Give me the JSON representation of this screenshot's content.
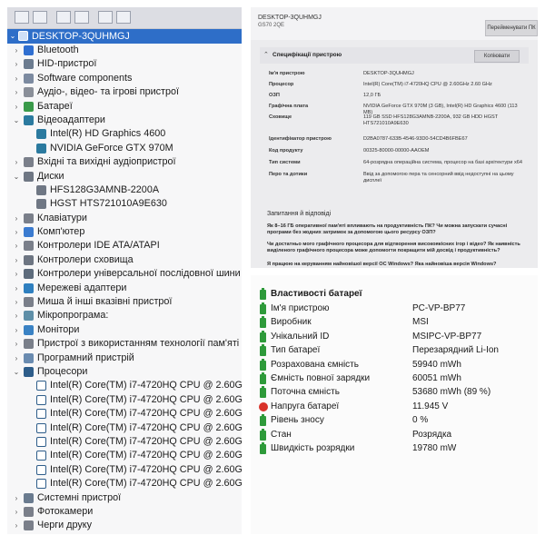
{
  "device_manager": {
    "root": "DESKTOP-3QUHMGJ",
    "items": [
      {
        "level": 1,
        "expander": "›",
        "icon": "bluetooth-icon",
        "label": "Bluetooth"
      },
      {
        "level": 1,
        "expander": "›",
        "icon": "hid-icon",
        "label": "HID-пристрої"
      },
      {
        "level": 1,
        "expander": "›",
        "icon": "software-components-icon",
        "label": "Software components"
      },
      {
        "level": 1,
        "expander": "›",
        "icon": "audio-icon",
        "label": "Аудіо-, відео- та ігрові пристрої"
      },
      {
        "level": 1,
        "expander": "›",
        "icon": "battery-icon",
        "label": "Батареї"
      },
      {
        "level": 1,
        "expander": "⌄",
        "icon": "display-adapter-icon",
        "label": "Відеоадаптери"
      },
      {
        "level": 2,
        "expander": "",
        "icon": "display-adapter-icon",
        "label": "Intel(R) HD Graphics 4600"
      },
      {
        "level": 2,
        "expander": "",
        "icon": "display-adapter-icon",
        "label": "NVIDIA GeForce GTX 970M"
      },
      {
        "level": 1,
        "expander": "›",
        "icon": "audio-io-icon",
        "label": "Вхідні та вихідні аудіопристрої"
      },
      {
        "level": 1,
        "expander": "⌄",
        "icon": "disk-icon",
        "label": "Диски"
      },
      {
        "level": 2,
        "expander": "",
        "icon": "disk-icon",
        "label": "HFS128G3AMNB-2200A"
      },
      {
        "level": 2,
        "expander": "",
        "icon": "disk-icon",
        "label": "HGST HTS721010A9E630"
      },
      {
        "level": 1,
        "expander": "›",
        "icon": "keyboard-icon",
        "label": "Клавіатури"
      },
      {
        "level": 1,
        "expander": "›",
        "icon": "computer-icon",
        "label": "Комп'ютер"
      },
      {
        "level": 1,
        "expander": "›",
        "icon": "ide-controller-icon",
        "label": "Контролери IDE ATA/ATAPI"
      },
      {
        "level": 1,
        "expander": "›",
        "icon": "storage-controller-icon",
        "label": "Контролери сховища"
      },
      {
        "level": 1,
        "expander": "›",
        "icon": "usb-controller-icon",
        "label": "Контролери універсальної послідовної шини"
      },
      {
        "level": 1,
        "expander": "›",
        "icon": "network-adapter-icon",
        "label": "Мережеві адаптери"
      },
      {
        "level": 1,
        "expander": "›",
        "icon": "mouse-icon",
        "label": "Миша й інші вказівні пристрої"
      },
      {
        "level": 1,
        "expander": "›",
        "icon": "firmware-icon",
        "label": "Мікропрограма:"
      },
      {
        "level": 1,
        "expander": "›",
        "icon": "monitor-icon",
        "label": "Монітори"
      },
      {
        "level": 1,
        "expander": "›",
        "icon": "memory-tech-icon",
        "label": "Пристрої з використанням технології пам'яті"
      },
      {
        "level": 1,
        "expander": "›",
        "icon": "software-device-icon",
        "label": "Програмний пристрій"
      },
      {
        "level": 1,
        "expander": "⌄",
        "icon": "processor-icon",
        "label": "Процесори"
      },
      {
        "level": 2,
        "expander": "",
        "icon": "processor-icon",
        "label": "Intel(R) Core(TM) i7-4720HQ CPU @ 2.60GHz"
      },
      {
        "level": 2,
        "expander": "",
        "icon": "processor-icon",
        "label": "Intel(R) Core(TM) i7-4720HQ CPU @ 2.60GHz"
      },
      {
        "level": 2,
        "expander": "",
        "icon": "processor-icon",
        "label": "Intel(R) Core(TM) i7-4720HQ CPU @ 2.60GHz"
      },
      {
        "level": 2,
        "expander": "",
        "icon": "processor-icon",
        "label": "Intel(R) Core(TM) i7-4720HQ CPU @ 2.60GHz"
      },
      {
        "level": 2,
        "expander": "",
        "icon": "processor-icon",
        "label": "Intel(R) Core(TM) i7-4720HQ CPU @ 2.60GHz"
      },
      {
        "level": 2,
        "expander": "",
        "icon": "processor-icon",
        "label": "Intel(R) Core(TM) i7-4720HQ CPU @ 2.60GHz"
      },
      {
        "level": 2,
        "expander": "",
        "icon": "processor-icon",
        "label": "Intel(R) Core(TM) i7-4720HQ CPU @ 2.60GHz"
      },
      {
        "level": 2,
        "expander": "",
        "icon": "processor-icon",
        "label": "Intel(R) Core(TM) i7-4720HQ CPU @ 2.60GHz"
      },
      {
        "level": 1,
        "expander": "›",
        "icon": "system-devices-icon",
        "label": "Системні пристрої"
      },
      {
        "level": 1,
        "expander": "›",
        "icon": "camera-icon",
        "label": "Фотокамери"
      },
      {
        "level": 1,
        "expander": "›",
        "icon": "print-queue-icon",
        "label": "Черги друку"
      }
    ]
  },
  "spec": {
    "pc_name": "DESKTOP-3QUHMGJ",
    "model": "GS70 2QE",
    "rename_button": "Перейменувати ПК",
    "section_title": "Специфікації пристрою",
    "copy_button": "Копіювати",
    "rows": [
      {
        "key": "Ім'я пристрою",
        "value": "DESKTOP-3QUHMGJ"
      },
      {
        "key": "Процесор",
        "value": "Intel(R) Core(TM) i7-4720HQ CPU @ 2.60GHz   2.60 GHz"
      },
      {
        "key": "ОЗП",
        "value": "12,0 ГБ"
      },
      {
        "key": "Графічна плата",
        "value": "NVIDIA GeForce GTX 970M (3 GB), Intel(R) HD Graphics 4600 (113 MB)"
      },
      {
        "key": "Сховище",
        "value": "119 GB SSD HFS128G3AMNB-2200A, 932 GB HDD HGST HTS721010A9E630"
      },
      {
        "key": "Ідентифікатор пристрою",
        "value": "D2BA0787-633B-4546-93D0-54CD4B6FBE67"
      },
      {
        "key": "Код продукту",
        "value": "00325-80000-00000-AAOEM"
      },
      {
        "key": "Тип системи",
        "value": "64-розрядна операційна система, процесор на базі архітектури x64"
      },
      {
        "key": "Перо та дотики",
        "value": "Ввід за допомогою пера та сенсорний ввід недоступні на цьому дисплеї"
      }
    ],
    "faq_title": "Запитання й відповіді",
    "faq": [
      "Як 8–16 ГБ оперативної пам'яті впливають на продуктивність ПК? Чи можна запускати сучасні програми без жодних затримок за допомогою цього ресурсу ОЗП?",
      "Чи достатньо мого графічного процесора для відтворення високоякісних ігор і відео? Як наявність виділеного графічного процесора може допомогти покращити мій досвід і продуктивність?",
      "Я працюю на керуванням найновішої версії ОС Windows? Яка найновіша версія Windows?"
    ]
  },
  "battery": {
    "title": "Властивості батареї",
    "rows": [
      {
        "icon": "battery-icon",
        "key": "Ім'я пристрою",
        "value": "PC-VP-BP77"
      },
      {
        "icon": "battery-icon",
        "key": "Виробник",
        "value": "MSI"
      },
      {
        "icon": "battery-icon",
        "key": "Унікальний ID",
        "value": "MSIPC-VP-BP77"
      },
      {
        "icon": "battery-icon",
        "key": "Тип батареї",
        "value": "Перезарядний Li-Ion"
      },
      {
        "icon": "battery-icon",
        "key": "Розрахована ємність",
        "value": "59940 mWh"
      },
      {
        "icon": "battery-icon",
        "key": "Ємність повної зарядки",
        "value": "60051 mWh"
      },
      {
        "icon": "battery-icon",
        "key": "Поточна ємність",
        "value": "53680 mWh  (89 %)"
      },
      {
        "icon": "warning-icon",
        "key": "Напруга батареї",
        "value": "11.945 V"
      },
      {
        "icon": "battery-icon",
        "key": "Рівень зносу",
        "value": "0 %"
      },
      {
        "icon": "battery-icon",
        "key": "Стан",
        "value": "Розрядка"
      },
      {
        "icon": "battery-icon",
        "key": "Швидкість розрядки",
        "value": "19780 mW"
      }
    ]
  },
  "colors": {
    "root_highlight": "#2e6ec8",
    "battery_icon": "#2e9a3a",
    "warning_icon": "#d9322a"
  }
}
